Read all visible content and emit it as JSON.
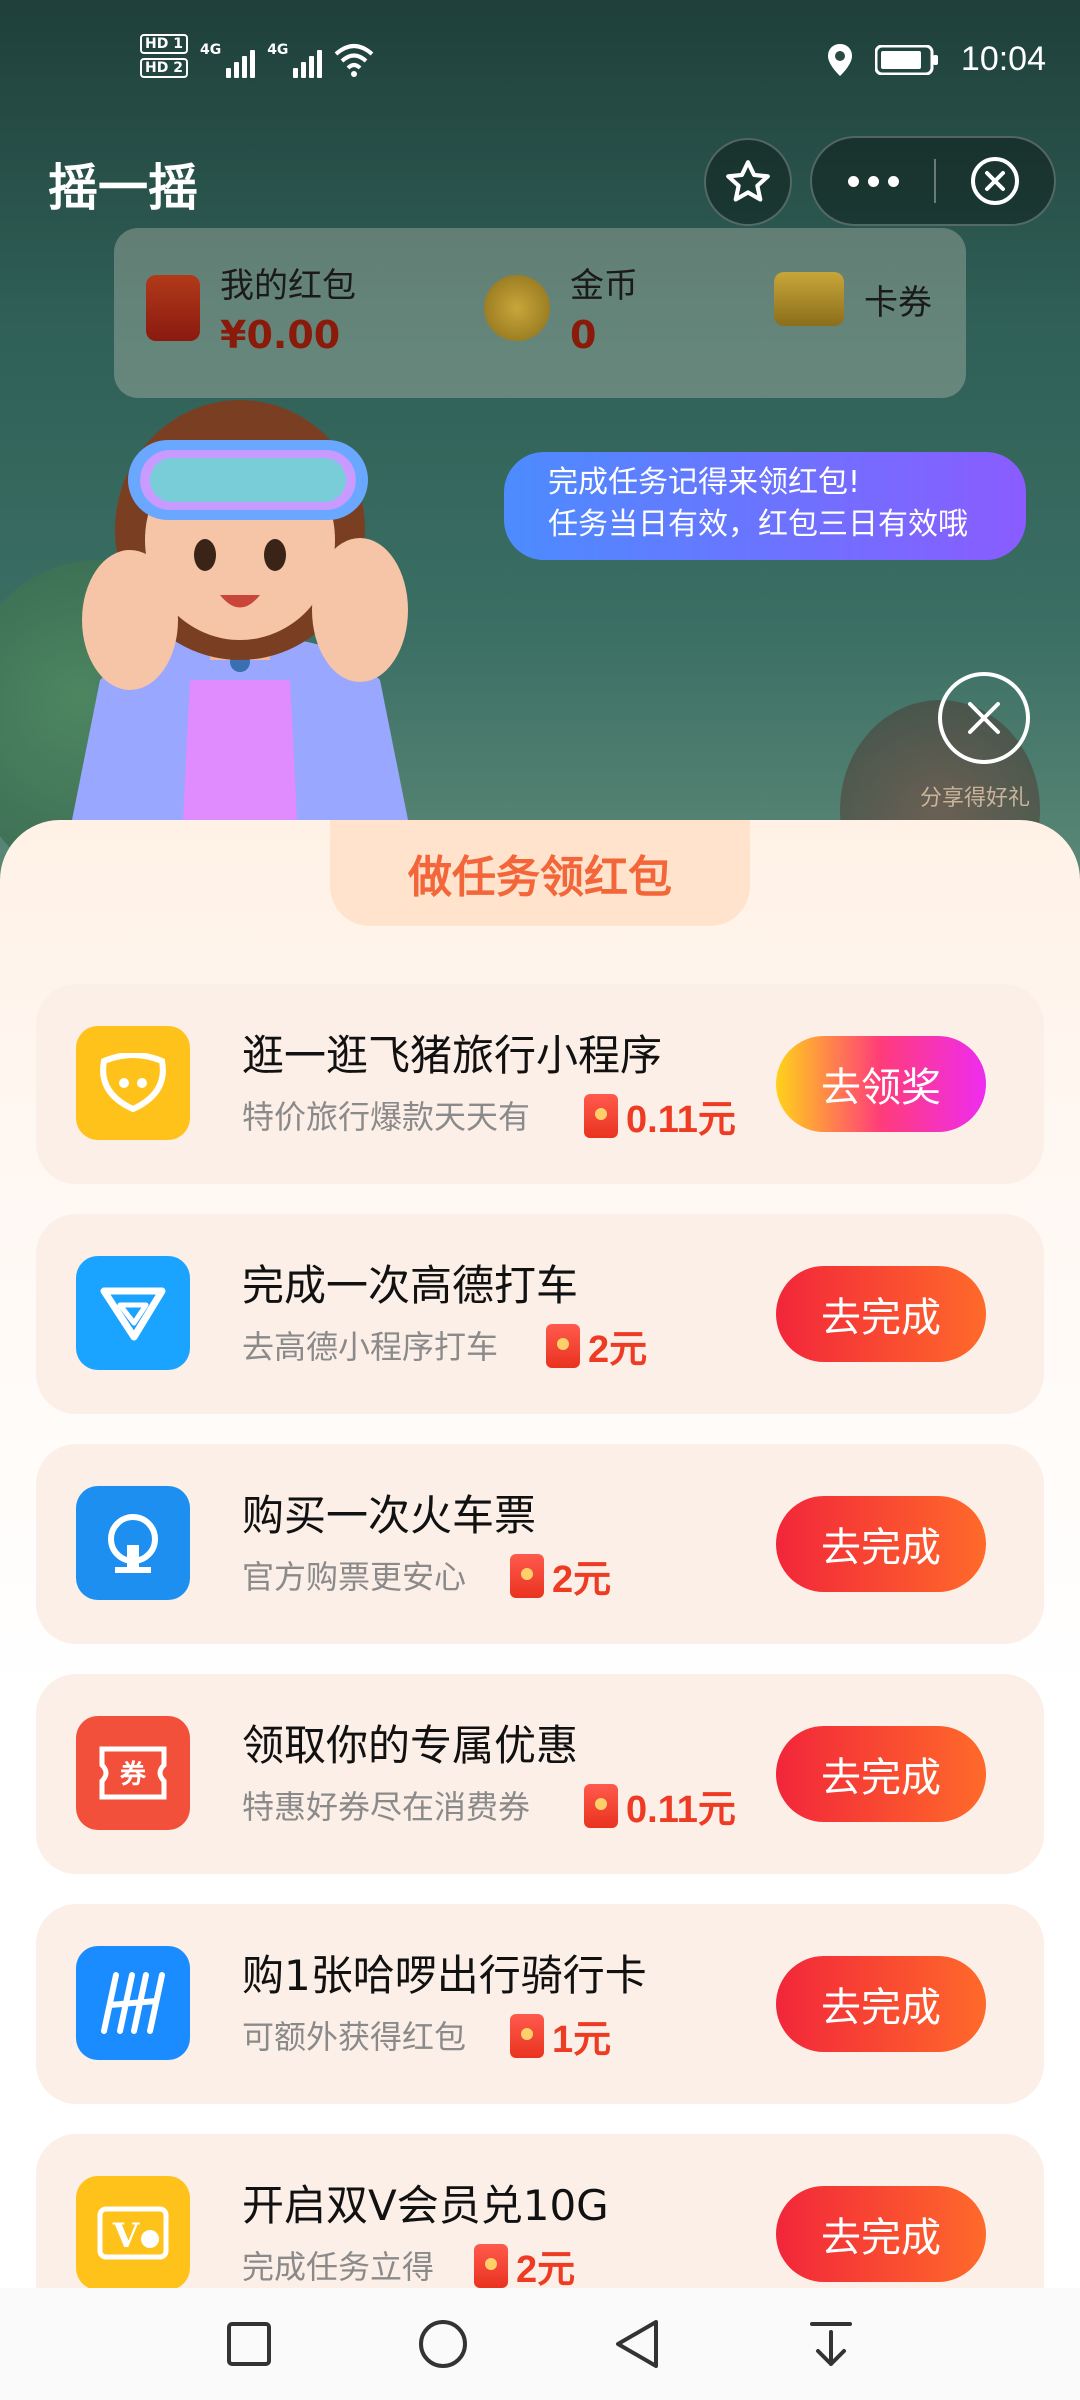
{
  "status_bar": {
    "hd1": "HD 1",
    "hd2": "HD 2",
    "net1": "4G",
    "net2": "4G",
    "time": "10:04"
  },
  "title_bar": {
    "title": "摇一摇"
  },
  "wallet": {
    "red_packet_label": "我的红包",
    "red_packet_value": "¥0.00",
    "coins_label": "金币",
    "coins_value": "0",
    "vouchers_label": "卡券"
  },
  "bubble": {
    "line1": "完成任务记得来领红包!",
    "line2": "任务当日有效，红包三日有效哦"
  },
  "share_label": "分享得好礼",
  "sheet": {
    "header": "做任务领红包",
    "tasks": [
      {
        "title": "逛一逛飞猪旅行小程序",
        "subtitle": "特价旅行爆款天天有",
        "reward": "0.11元",
        "button": "去领奖",
        "icon": "fliggy-icon",
        "icon_color": "#ffc21a"
      },
      {
        "title": "完成一次高德打车",
        "subtitle": "去高德小程序打车",
        "reward": "2元",
        "button": "去完成",
        "icon": "amap-taxi-icon",
        "icon_color": "#1aa3ff"
      },
      {
        "title": "购买一次火车票",
        "subtitle": "官方购票更安心",
        "reward": "2元",
        "button": "去完成",
        "icon": "train-ticket-icon",
        "icon_color": "#1d8ff0"
      },
      {
        "title": "领取你的专属优惠",
        "subtitle": "特惠好券尽在消费券",
        "reward": "0.11元",
        "button": "去完成",
        "icon": "coupon-icon",
        "icon_color": "#f2503a"
      },
      {
        "title": "购1张哈啰出行骑行卡",
        "subtitle": "可额外获得红包",
        "reward": "1元",
        "button": "去完成",
        "icon": "hellobike-icon",
        "icon_color": "#1a8cff"
      },
      {
        "title": "开启双V会员兑10G",
        "subtitle": "完成任务立得",
        "reward": "2元",
        "button": "去完成",
        "icon": "double-v-icon",
        "icon_color": "#ffc21a"
      }
    ]
  },
  "colors": {
    "accent": "#f2663a",
    "button_gradient_start": "#f2263a",
    "button_gradient_end": "#ff6a2a",
    "reward": "#ee3b23",
    "bubble_start": "#4c8cff",
    "bubble_end": "#8a5cff"
  }
}
